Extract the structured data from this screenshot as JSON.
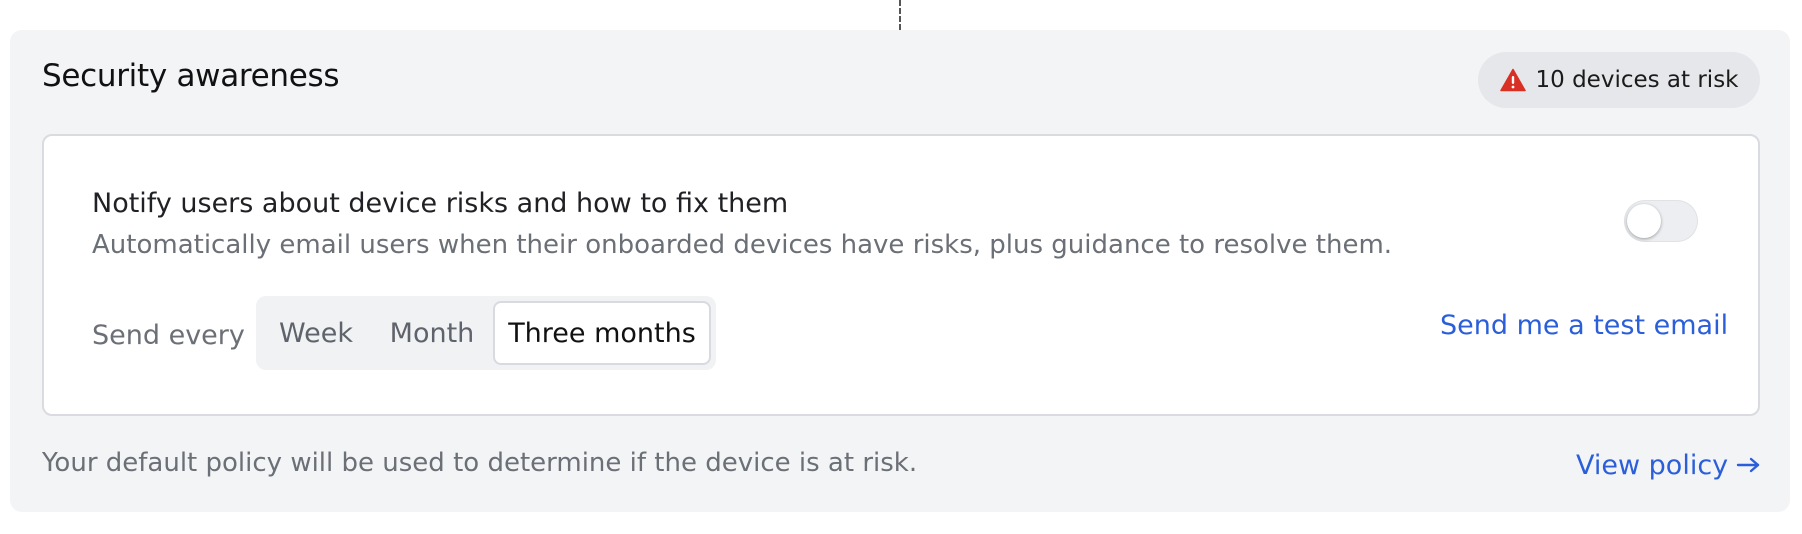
{
  "panel": {
    "title": "Security awareness",
    "risk_badge": {
      "icon": "warning-triangle-icon",
      "icon_color": "#d93025",
      "text": "10 devices at risk"
    }
  },
  "setting": {
    "title": "Notify users about device risks and how to fix them",
    "description": "Automatically email users when their onboarded devices have risks, plus guidance to resolve them.",
    "toggle_enabled": false,
    "frequency_label": "Send every",
    "frequency_options": [
      "Week",
      "Month",
      "Three months"
    ],
    "selected_frequency": "Three months",
    "test_email_link": "Send me a test email"
  },
  "footer": {
    "note": "Your default policy will be used to determine if the device is at risk.",
    "view_policy_link": "View policy",
    "view_policy_icon": "arrow-right-icon"
  },
  "colors": {
    "accent": "#2b5fd9",
    "panel_bg": "#f3f4f6",
    "warning": "#d93025"
  }
}
